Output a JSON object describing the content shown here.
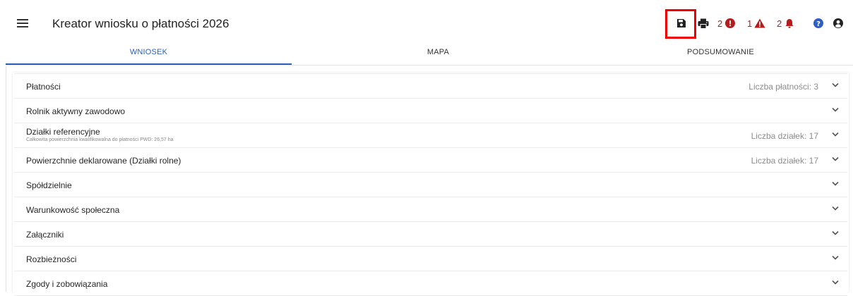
{
  "header": {
    "title": "Kreator wniosku o płatności 2026",
    "menu_icon": "hamburger-menu-icon",
    "toolbar": {
      "save_icon": "save-icon",
      "print_icon": "print-icon",
      "errors_count": "2",
      "errors_icon": "error-circle-icon",
      "warnings_count": "1",
      "warnings_icon": "warning-triangle-icon",
      "notifications_count": "2",
      "notifications_icon": "bell-icon",
      "help_icon": "help-icon",
      "account_icon": "account-icon"
    },
    "highlight_color": "#ee0000",
    "alert_color": "#b71c1c",
    "help_color": "#2f5fc4"
  },
  "tabs": [
    {
      "label": "WNIOSEK",
      "active": true
    },
    {
      "label": "MAPA",
      "active": false
    },
    {
      "label": "PODSUMOWANIE",
      "active": false
    }
  ],
  "accent_color": "#2b5eb8",
  "sections": [
    {
      "title": "Płatności",
      "subtitle": "",
      "meta": "Liczba płatności: 3"
    },
    {
      "title": "Rolnik aktywny zawodowo",
      "subtitle": "",
      "meta": ""
    },
    {
      "title": "Działki referencyjne",
      "subtitle": "Całkowita powierzchnia kwalifikowalna do płatności PWD: 26,57 ha",
      "meta": "Liczba działek: 17"
    },
    {
      "title": "Powierzchnie deklarowane (Działki rolne)",
      "subtitle": "",
      "meta": "Liczba działek: 17"
    },
    {
      "title": "Spółdzielnie",
      "subtitle": "",
      "meta": ""
    },
    {
      "title": "Warunkowość społeczna",
      "subtitle": "",
      "meta": ""
    },
    {
      "title": "Załączniki",
      "subtitle": "",
      "meta": ""
    },
    {
      "title": "Rozbieżności",
      "subtitle": "",
      "meta": ""
    },
    {
      "title": "Zgody i zobowiązania",
      "subtitle": "",
      "meta": ""
    }
  ]
}
